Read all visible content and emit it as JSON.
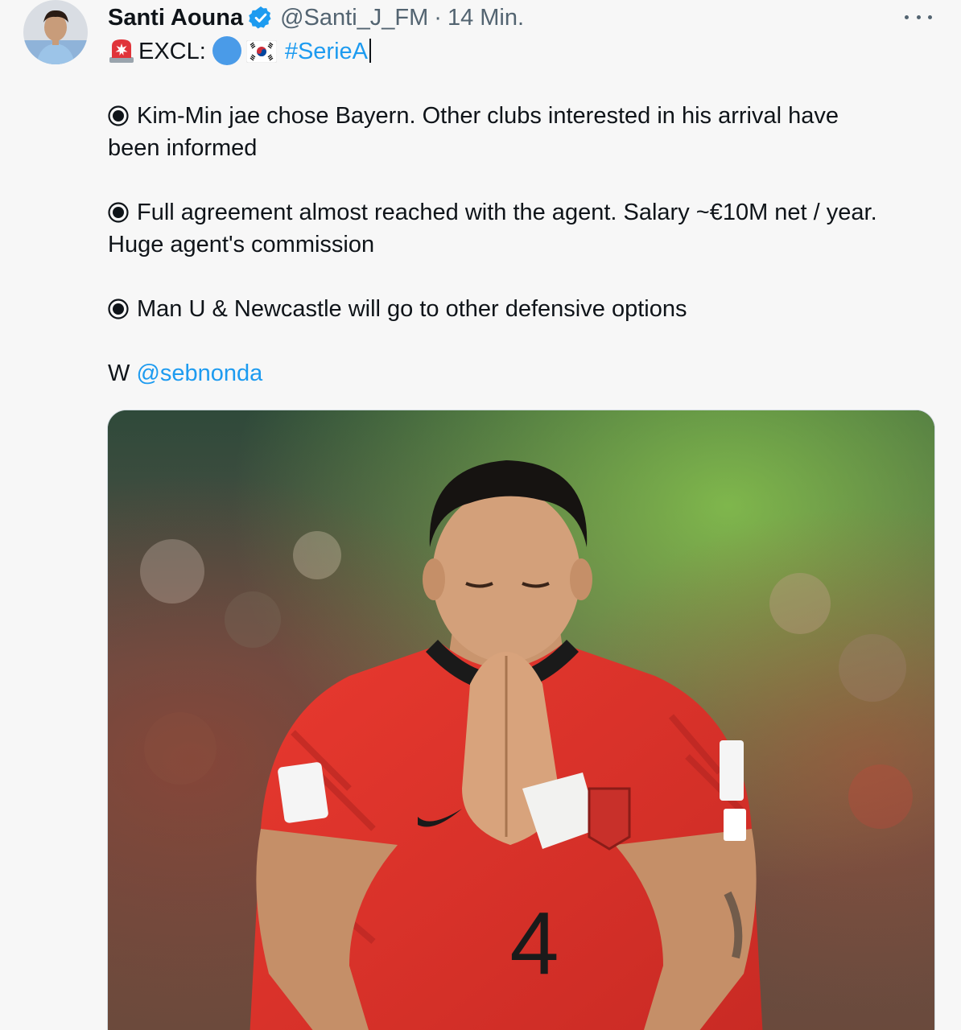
{
  "tweet": {
    "author_name": "Santi Aouna",
    "handle": "@Santi_J_FM",
    "separator": "·",
    "time": "14 Min.",
    "excl_label": "EXCL:",
    "hashtag": "#SerieA",
    "bullets": [
      {
        "line1": "Kim-Min jae chose Bayern. Other clubs interested in his arrival have",
        "line2": "been informed"
      },
      {
        "line1": "Full agreement almost reached with the agent. Salary ~€10M net / year.",
        "line2": "Huge agent's commission"
      },
      {
        "line1": "Man U & Newcastle will go to other defensive options"
      }
    ],
    "credit_prefix": "W",
    "credit_mention": "@sebnonda"
  },
  "icons": {
    "verified": "verified-badge-icon",
    "more": "more-options-icon",
    "siren": "rotating-light-icon",
    "blue_circle": "blue-circle-emoji",
    "flag": "south-korea-flag-emoji",
    "bullet": "radio-button-icon"
  },
  "colors": {
    "link": "#1d9bf0",
    "text": "#0f1419",
    "secondary": "#536471",
    "verified": "#1d9bf0",
    "jersey": "#e2342c"
  },
  "photo": {
    "jersey_number": "4"
  }
}
